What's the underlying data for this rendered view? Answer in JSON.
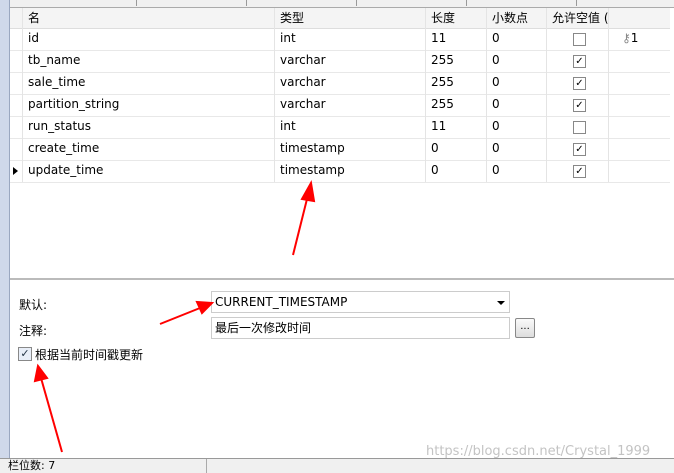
{
  "columns": [
    "名",
    "类型",
    "长度",
    "小数点",
    "允许空值 ("
  ],
  "rows": [
    {
      "name": "id",
      "type": "int",
      "length": "11",
      "decimal": "0",
      "nullable": false,
      "key": "1"
    },
    {
      "name": "tb_name",
      "type": "varchar",
      "length": "255",
      "decimal": "0",
      "nullable": true,
      "key": ""
    },
    {
      "name": "sale_time",
      "type": "varchar",
      "length": "255",
      "decimal": "0",
      "nullable": true,
      "key": ""
    },
    {
      "name": "partition_string",
      "type": "varchar",
      "length": "255",
      "decimal": "0",
      "nullable": true,
      "key": ""
    },
    {
      "name": "run_status",
      "type": "int",
      "length": "11",
      "decimal": "0",
      "nullable": false,
      "key": ""
    },
    {
      "name": "create_time",
      "type": "timestamp",
      "length": "0",
      "decimal": "0",
      "nullable": true,
      "key": ""
    },
    {
      "name": "update_time",
      "type": "timestamp",
      "length": "0",
      "decimal": "0",
      "nullable": true,
      "key": ""
    }
  ],
  "props": {
    "default_label": "默认:",
    "default_value": "CURRENT_TIMESTAMP",
    "comment_label": "注释:",
    "comment_value": "最后一次修改时间",
    "browse_label": "...",
    "on_update_label": "根据当前时间戳更新",
    "on_update_checked": true
  },
  "status": {
    "field_count": "栏位数: 7"
  },
  "watermark": "https://blog.csdn.net/Crystal_1999"
}
